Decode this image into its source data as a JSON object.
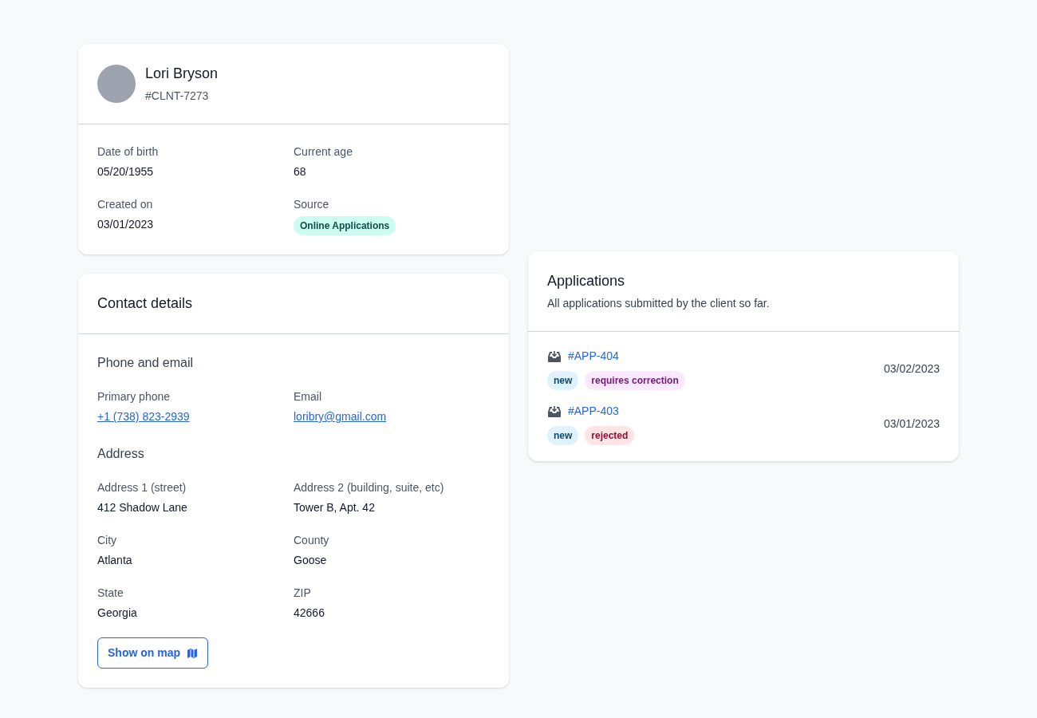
{
  "profile": {
    "name": "Lori Bryson",
    "id": "#CLNT-7273",
    "fields": [
      {
        "label": "Date of birth",
        "value": "05/20/1955"
      },
      {
        "label": "Current age",
        "value": "68"
      },
      {
        "label": "Created on",
        "value": "03/01/2023"
      },
      {
        "label": "Source",
        "value": "Online Applications",
        "kind": "badge"
      }
    ]
  },
  "contact": {
    "title": "Contact details",
    "sections": [
      {
        "title": "Phone and email",
        "fields": [
          {
            "label": "Primary phone",
            "value": "+1 (738) 823-2939",
            "kind": "link"
          },
          {
            "label": "Email",
            "value": "loribry@gmail.com",
            "kind": "link"
          }
        ]
      },
      {
        "title": "Address",
        "fields": [
          {
            "label": "Address 1 (street)",
            "value": "412 Shadow Lane",
            "kind": "text"
          },
          {
            "label": "Address 2 (building, suite, etc)",
            "value": "Tower B, Apt. 42",
            "kind": "text"
          },
          {
            "label": "City",
            "value": "Atlanta",
            "kind": "text"
          },
          {
            "label": "County",
            "value": "Goose",
            "kind": "text"
          },
          {
            "label": "State",
            "value": "Georgia",
            "kind": "text"
          },
          {
            "label": "ZIP",
            "value": "42666",
            "kind": "text"
          }
        ]
      }
    ],
    "button": "Show on map"
  },
  "applications": {
    "title": "Applications",
    "subtitle": "All applications submitted by the client so far.",
    "items": [
      {
        "id": "#APP-404",
        "date": "03/02/2023",
        "tags": [
          {
            "label": "new",
            "color": "#e0f2fe"
          },
          {
            "label": "requires correction",
            "color": "#fae8ff"
          }
        ]
      },
      {
        "id": "#APP-403",
        "date": "03/01/2023",
        "tags": [
          {
            "label": "new",
            "color": "#e0f2fe"
          },
          {
            "label": "rejected",
            "color": "#ffe4e6"
          }
        ]
      }
    ]
  }
}
